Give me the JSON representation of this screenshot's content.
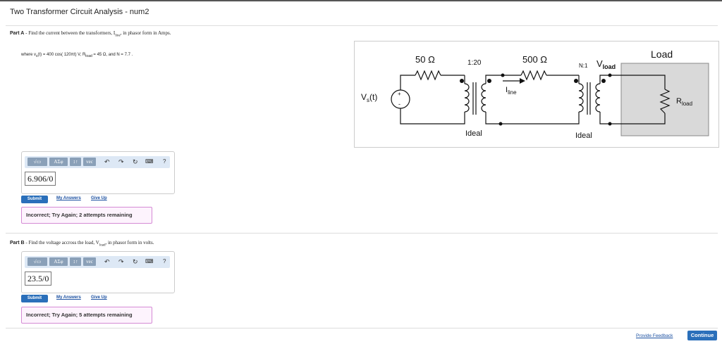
{
  "page": {
    "title": "Two Transformer Circuit Analysis - num2",
    "provide_feedback": "Provide Feedback",
    "continue": "Continue"
  },
  "partA": {
    "label_bold": "Part A",
    "label_text": " - Find the current between the transformers, I",
    "label_sub": "line",
    "label_end": ", in phasor form in Amps.",
    "where": "where v",
    "where_sub": "s",
    "where_mid": "(t) = 400 cos( 120πt) V, R",
    "where_sub2": "load",
    "where_end": " = 45 Ω, and N = 7.7 .",
    "answer_value": "6.906",
    "answer_angle": "0",
    "submit": "Submit",
    "my_answers": "My Answers",
    "give_up": "Give Up",
    "feedback": "Incorrect; Try Again; 2 attempts remaining"
  },
  "partB": {
    "label_bold": "Part B",
    "label_text": " - Find the voltage accross the load, V",
    "label_sub": "load",
    "label_end": ", in phasor form in volts.",
    "answer_value": "23.5",
    "answer_angle": "0",
    "submit": "Submit",
    "my_answers": "My Answers",
    "give_up": "Give Up",
    "feedback": "Incorrect; Try Again; 5 attempts remaining"
  },
  "toolbar": {
    "sqrt": "√▭",
    "greek": "ΑΣφ",
    "arrows": "↕↑",
    "vec": "vec",
    "undo_icon": "undo-icon",
    "redo_icon": "redo-icon",
    "reset_icon": "reset-icon",
    "keyboard_icon": "keyboard-icon",
    "help": "?"
  },
  "circuit": {
    "r1": "50 Ω",
    "ratio1": "1:20",
    "r2": "500 Ω",
    "ratio2": "N:1",
    "vload": "V",
    "vload_sub": "load",
    "load": "Load",
    "iline": "I",
    "iline_sub": "line",
    "rload": "R",
    "rload_sub": "load",
    "vs": "V",
    "vs_sub": "s",
    "vs_end": "(t)",
    "ideal1": "Ideal",
    "ideal2": "Ideal",
    "plus": "+",
    "minus": "-"
  },
  "colors": {
    "accent": "#2a6fba",
    "feedback_border": "#d58ad5",
    "toolbar_bg": "#dde8f5",
    "load_box": "#d9d9d9"
  }
}
